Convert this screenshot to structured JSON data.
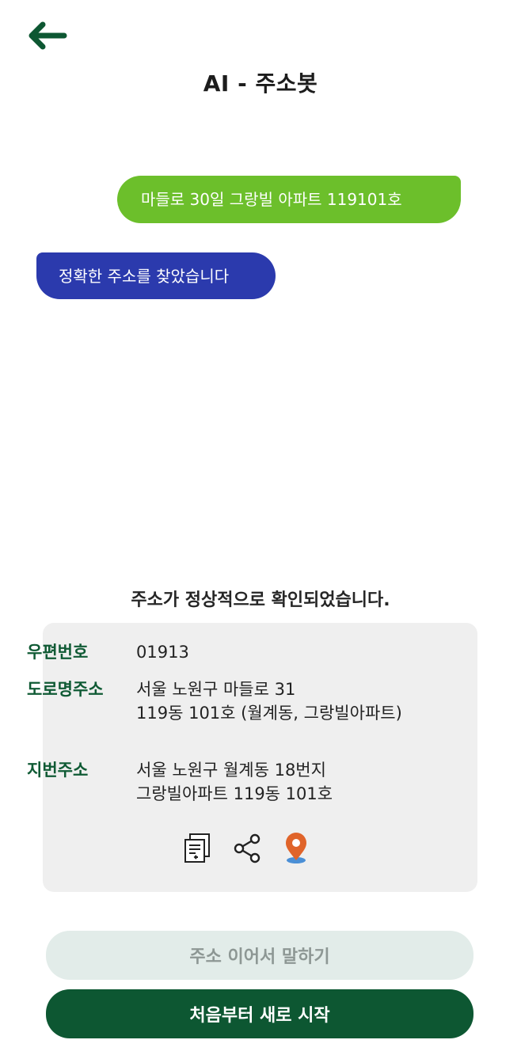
{
  "header": {
    "back_icon": "arrow-left-icon",
    "title": "AI - 주소봇",
    "accent_color": "#0d5732"
  },
  "chat": {
    "user_message": "마들로 30일 그랑빌 아파트 119101호",
    "bot_message": "정확한 주소를 찾았습니다",
    "user_bubble_color": "#6cbf2b",
    "bot_bubble_color": "#2b3aad"
  },
  "result": {
    "confirm_text": "주소가 정상적으로 확인되었습니다.",
    "postal_label": "우편번호",
    "postal_value": "01913",
    "road_label": "도로명주소",
    "road_line1": "서울 노원구 마들로 31",
    "road_line2": "119동 101호 (월계동, 그랑빌아파트)",
    "jibun_label": "지번주소",
    "jibun_line1": "서울 노원구 월계동 18번지",
    "jibun_line2": "그랑빌아파트 119동 101호",
    "action_icons": [
      "copy-icon",
      "share-icon",
      "map-pin-icon"
    ]
  },
  "buttons": {
    "continue_label": "주소 이어서 말하기",
    "restart_label": "처음부터 새로 시작"
  }
}
